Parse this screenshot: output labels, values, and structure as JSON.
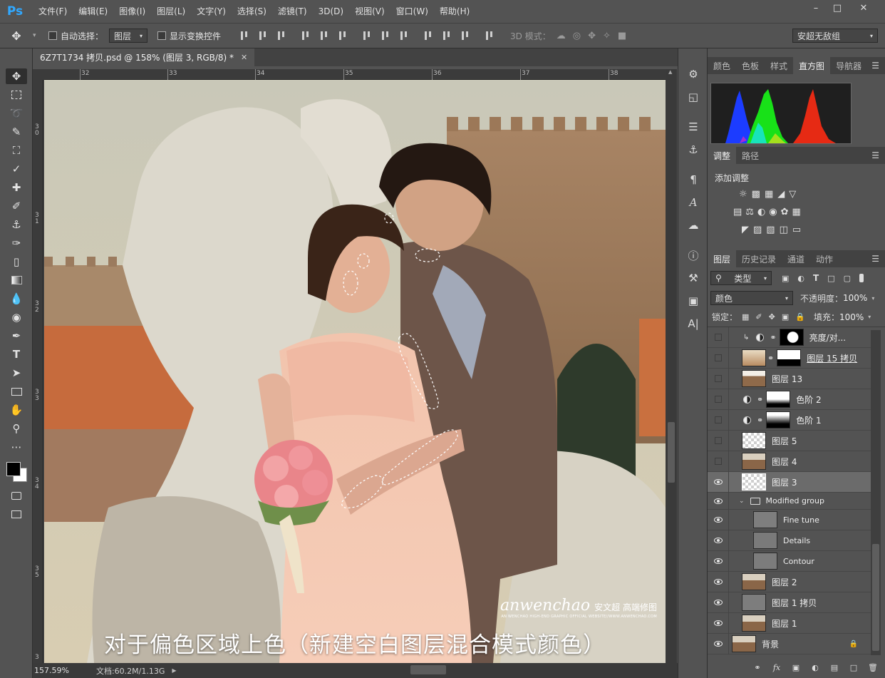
{
  "app": {
    "logo": "Ps",
    "menu": [
      "文件(F)",
      "编辑(E)",
      "图像(I)",
      "图层(L)",
      "文字(Y)",
      "选择(S)",
      "滤镜(T)",
      "3D(D)",
      "视图(V)",
      "窗口(W)",
      "帮助(H)"
    ],
    "window_controls": [
      "minimize-icon",
      "maximize-icon",
      "close-icon"
    ]
  },
  "options": {
    "auto_select_label": "自动选择：",
    "auto_select_target": "图层",
    "show_transform_label": "显示变换控件",
    "mode_3d_label": "3D 模式：",
    "workspace": "安超无敌组"
  },
  "document": {
    "tab_title": "6Z7T1734 拷贝.psd @ 158% (图层 3, RGB/8) *",
    "ruler_h": [
      "32",
      "33",
      "34",
      "35",
      "36",
      "37",
      "38"
    ],
    "ruler_v": [
      "3\n0",
      "3\n1",
      "3\n2",
      "3\n3",
      "3\n4",
      "3\n5",
      "3"
    ],
    "caption": "对于偏色区域上色（新建空白图层混合模式颜色）",
    "watermark_logo": "anwenchao",
    "watermark_cn": "安文超 高端修图",
    "watermark_small": "AN WENCHAO HIGH-END GRAPHIC OFFICIAL WEBSITE//WWW.ANWENCHAO.COM",
    "zoom": "157.59%",
    "doc_size": "文档:60.2M/1.13G"
  },
  "histogram_panel": {
    "tabs": [
      "颜色",
      "色板",
      "样式",
      "直方图",
      "导航器"
    ],
    "active": "直方图"
  },
  "adjust_panel": {
    "tabs": [
      "调整",
      "路径"
    ],
    "title": "添加调整"
  },
  "layers_panel": {
    "tabs": [
      "图层",
      "历史记录",
      "通道",
      "动作"
    ],
    "filter_type": "类型",
    "blend_mode": "颜色",
    "opacity_label": "不透明度：",
    "opacity": "100%",
    "lock_label": "锁定：",
    "fill_label": "填充：",
    "fill": "100%",
    "layers": [
      {
        "name": "亮度/对...",
        "visible": false
      },
      {
        "name": "图层 15 拷贝",
        "visible": false
      },
      {
        "name": "图层 13",
        "visible": false
      },
      {
        "name": "色阶 2",
        "visible": false
      },
      {
        "name": "色阶 1",
        "visible": false
      },
      {
        "name": "图层 5",
        "visible": false
      },
      {
        "name": "图层 4",
        "visible": false
      },
      {
        "name": "图层 3",
        "visible": true,
        "selected": true
      },
      {
        "name": "Modified group",
        "visible": true
      },
      {
        "name": "Fine tune",
        "visible": true
      },
      {
        "name": "Details",
        "visible": true
      },
      {
        "name": "Contour",
        "visible": true
      },
      {
        "name": "图层 2",
        "visible": true
      },
      {
        "name": "图层 1 拷贝",
        "visible": true
      },
      {
        "name": "图层 1",
        "visible": true
      },
      {
        "name": "背景",
        "visible": true
      }
    ]
  }
}
